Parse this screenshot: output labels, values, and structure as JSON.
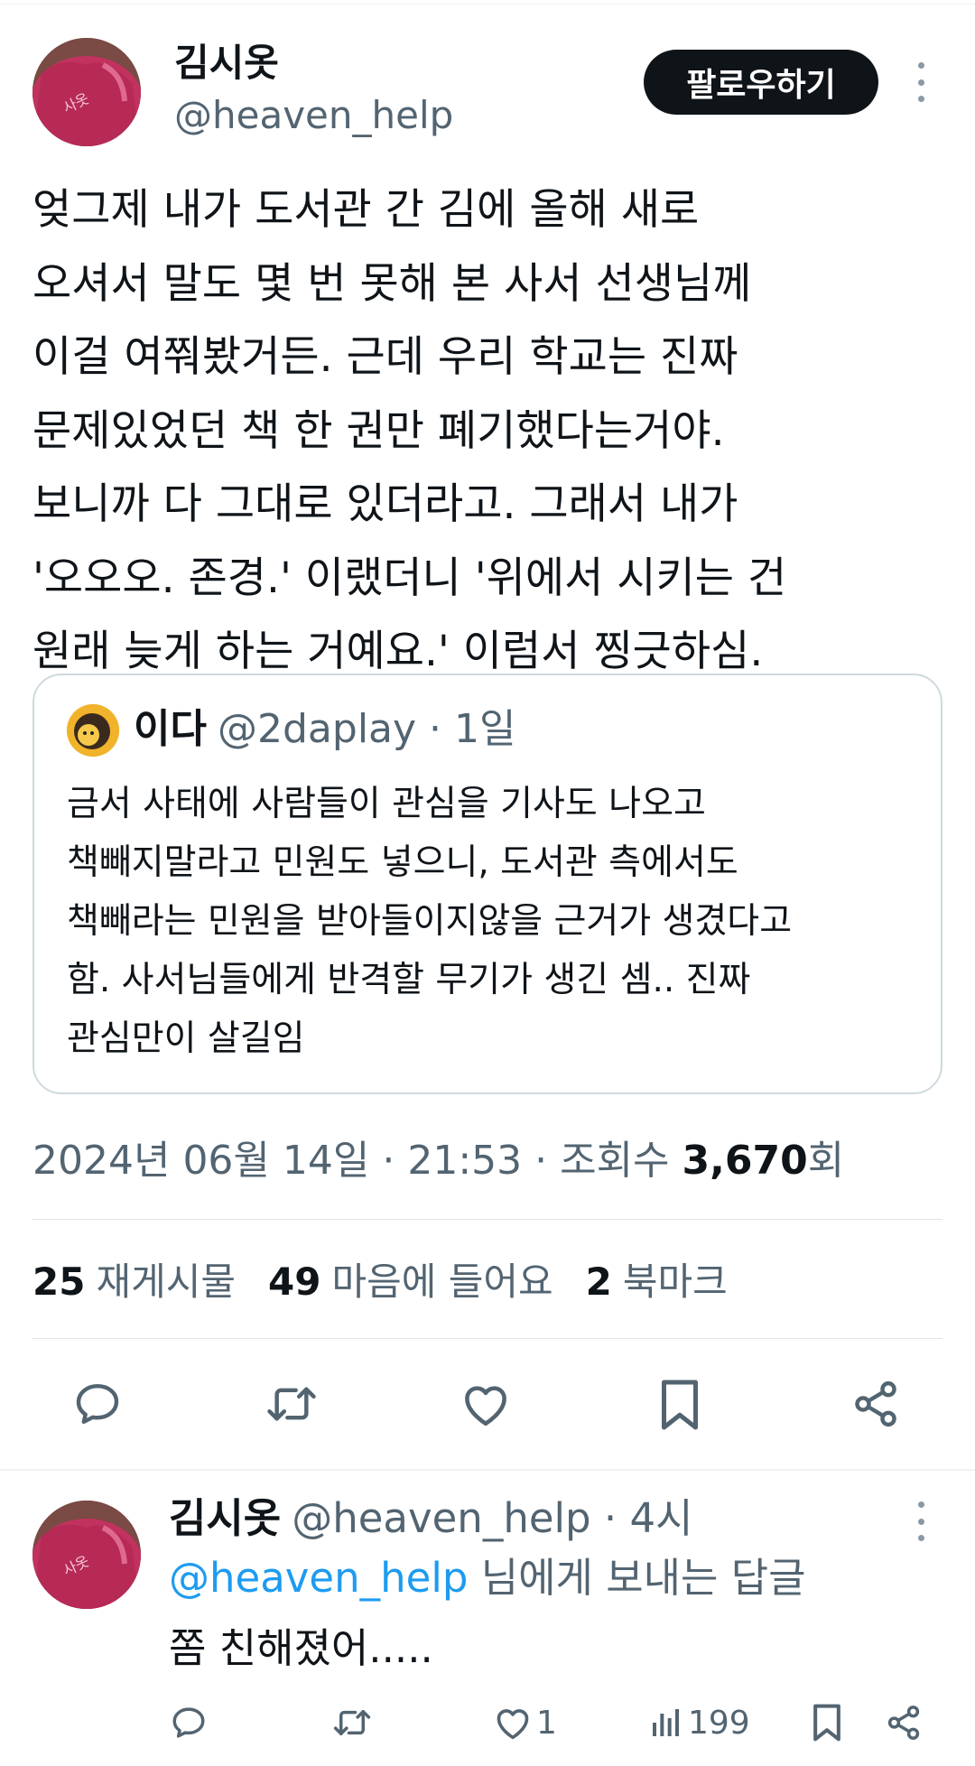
{
  "tweet": {
    "author_name": "김시옷",
    "author_handle": "@heaven_help",
    "follow_label": "팔로우하기",
    "text": "엊그제 내가 도서관 간 김에 올해 새로\n오셔서 말도 몇 번 못해 본 사서 선생님께\n이걸 여쭤봤거든. 근데 우리 학교는 진짜\n문제있었던 책 한 권만 폐기했다는거야.\n보니까 다 그대로 있더라고. 그래서 내가\n'오오오. 존경.' 이랬더니 '위에서 시키는 건\n원래 늦게 하는 거예요.' 이럼서 찡긋하심.",
    "quote": {
      "name": "이다",
      "meta": "@2daplay · 1일",
      "text": "금서 사태에 사람들이 관심을 기사도 나오고\n책빼지말라고 민원도 넣으니, 도서관 측에서도\n책빼라는 민원을 받아들이지않을 근거가 생겼다고\n함. 사서님들에게 반격할 무기가 생긴 셈.. 진짜\n관심만이 살길임"
    },
    "timestamp": "2024년 06월 14일 · 21:53 · 조회수 ",
    "views_count": "3,670",
    "views_unit": "회",
    "stats": {
      "reposts_count": "25",
      "reposts_label": "재게시물",
      "likes_count": "49",
      "likes_label": "마음에 들어요",
      "bookmarks_count": "2",
      "bookmarks_label": "북마크"
    }
  },
  "reply": {
    "author_name": "김시옷",
    "meta": "@heaven_help · 4시",
    "mention": "@heaven_help",
    "replying_to_suffix": " 님에게 보내는 답글",
    "text": "쫌 친해졌어.....",
    "like_count": "1",
    "views_count": "199"
  },
  "colors": {
    "text_primary": "#0f1419",
    "text_secondary": "#536471",
    "mention": "#1d9bf0",
    "border": "#cfd9de"
  },
  "icons": [
    "reply-icon",
    "repost-icon",
    "like-icon",
    "bookmark-icon",
    "share-icon",
    "views-icon",
    "more-icon"
  ]
}
